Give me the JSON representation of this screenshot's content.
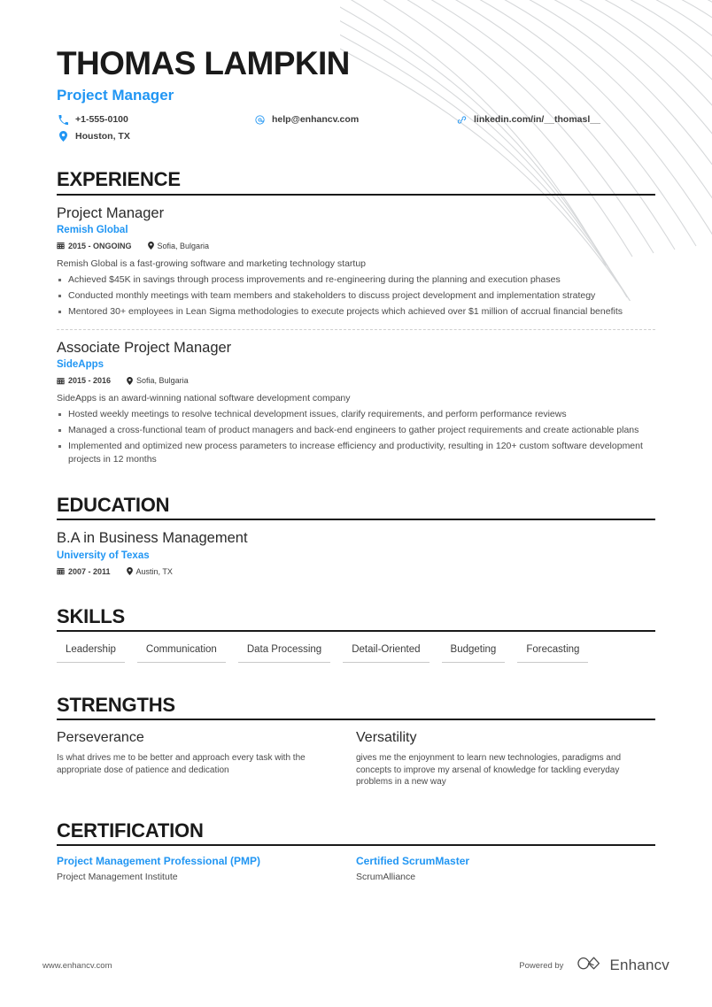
{
  "theme": {
    "accent": "#2196f3",
    "text": "#3c3c3c",
    "heading": "#1a1a1a",
    "rule": "#1a1a1a"
  },
  "header": {
    "full_name": "THOMAS LAMPKIN",
    "job_title": "Project Manager",
    "contacts": {
      "phone": "+1-555-0100",
      "location": "Houston, TX",
      "email": "help@enhancv.com",
      "linkedin": "linkedin.com/in/__thomasl__"
    }
  },
  "sections": {
    "experience": {
      "title": "EXPERIENCE",
      "entries": [
        {
          "role": "Project Manager",
          "company": "Remish Global",
          "date": "2015 - ONGOING",
          "location": "Sofia, Bulgaria",
          "summary": "Remish Global is a fast-growing software and marketing technology startup",
          "bullets": [
            "Achieved $45K in savings through process improvements and re-engineering during the planning and execution phases",
            "Conducted monthly meetings with team members and stakeholders to discuss project development and implementation strategy",
            "Mentored 30+ employees in Lean Sigma methodologies to execute projects which achieved over $1 million of accrual financial benefits"
          ]
        },
        {
          "role": "Associate Project Manager",
          "company": "SideApps",
          "date": "2015 - 2016",
          "location": "Sofia, Bulgaria",
          "summary": "SideApps is an award-winning national software development company",
          "bullets": [
            "Hosted weekly meetings to resolve technical development issues, clarify requirements, and perform performance reviews",
            "Managed a cross-functional team of product managers and back-end engineers to gather project requirements and create actionable plans",
            "Implemented and optimized new process parameters to increase efficiency and productivity, resulting in 120+ custom software development projects in 12 months"
          ]
        }
      ]
    },
    "education": {
      "title": "EDUCATION",
      "entries": [
        {
          "degree": "B.A in Business Management",
          "school": "University of Texas",
          "date": "2007 - 2011",
          "location": "Austin, TX"
        }
      ]
    },
    "skills": {
      "title": "SKILLS",
      "items": [
        "Leadership",
        "Communication",
        "Data Processing",
        "Detail-Oriented",
        "Budgeting",
        "Forecasting"
      ]
    },
    "strengths": {
      "title": "STRENGTHS",
      "items": [
        {
          "name": "Perseverance",
          "description": "Is what drives me to be better and approach every task with the appropriate dose of patience and dedication"
        },
        {
          "name": "Versatility",
          "description": "gives me the enjoynment to learn new technologies, paradigms and concepts to improve my arsenal of knowledge for tackling everyday problems in a new way"
        }
      ]
    },
    "certification": {
      "title": "CERTIFICATION",
      "items": [
        {
          "name": "Project Management Professional (PMP)",
          "organization": "Project Management Institute"
        },
        {
          "name": "Certified ScrumMaster",
          "organization": "ScrumAlliance"
        }
      ]
    }
  },
  "footer": {
    "url": "www.enhancv.com",
    "powered_by": "Powered by",
    "brand": "Enhancv"
  }
}
